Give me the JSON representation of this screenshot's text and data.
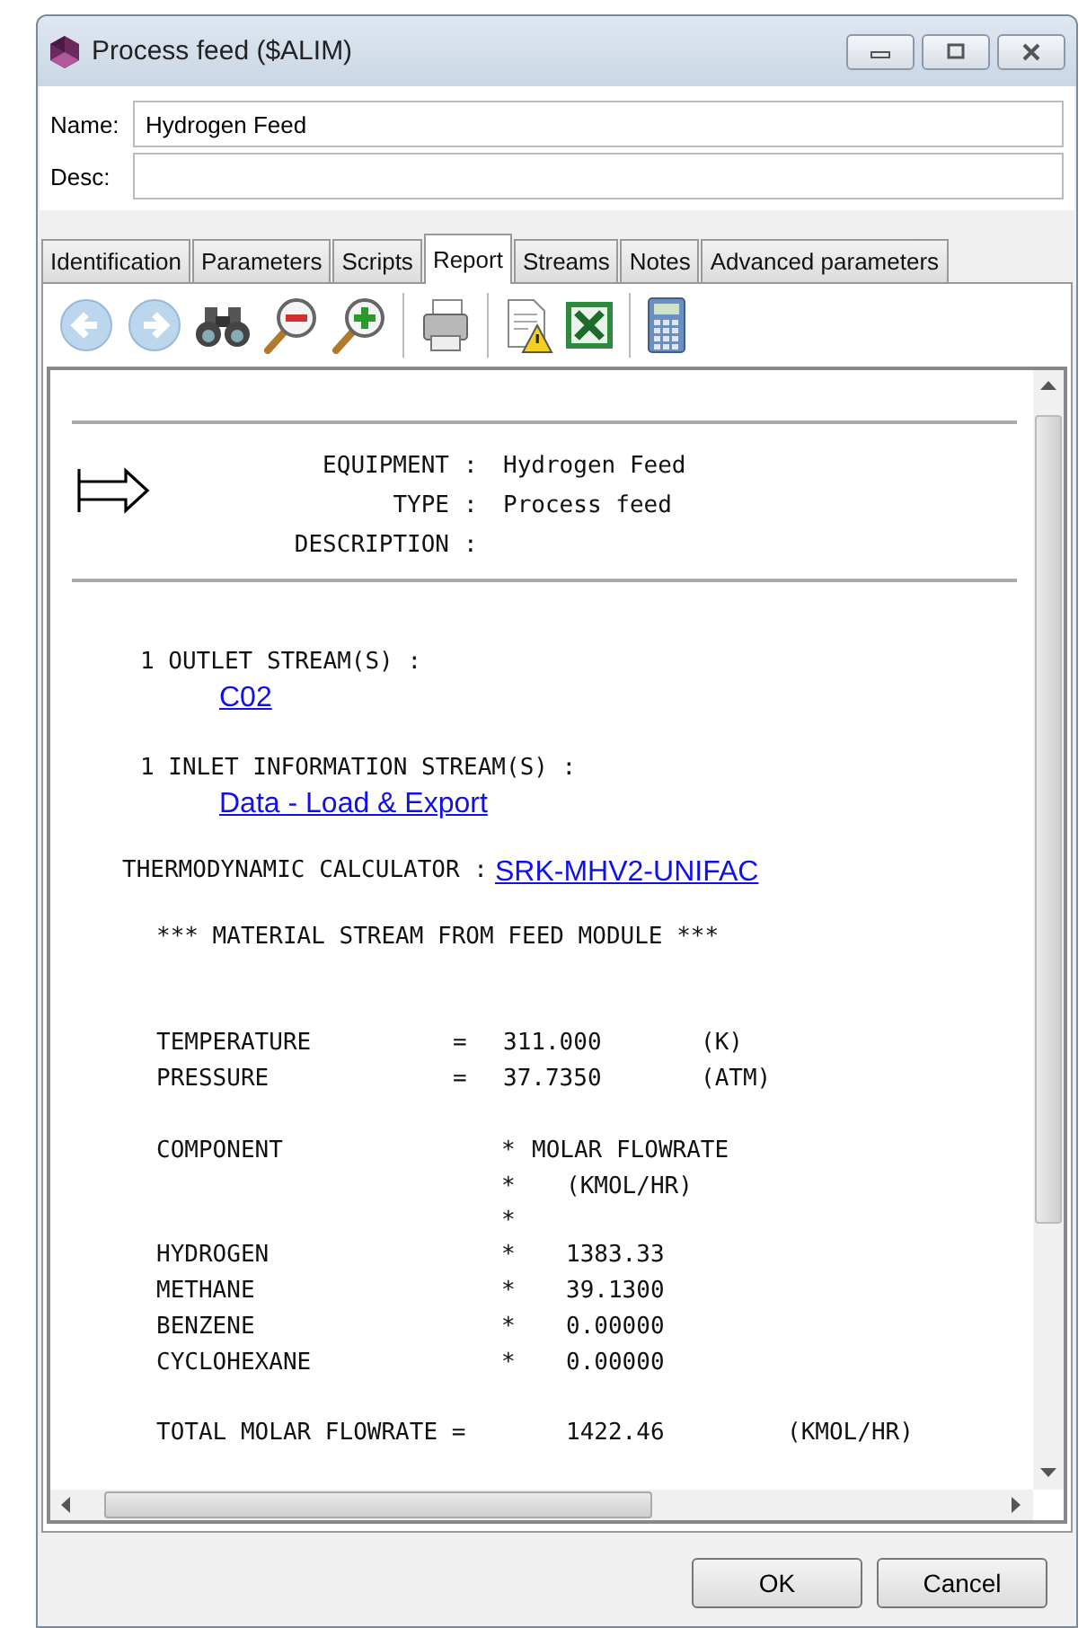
{
  "window": {
    "title": "Process feed ($ALIM)"
  },
  "fields": [
    {
      "label": "Name:",
      "value": "Hydrogen Feed"
    },
    {
      "label": "Desc:"
    }
  ],
  "tabs": [
    {
      "label": "Identification",
      "selected": false
    },
    {
      "label": "Parameters",
      "selected": false
    },
    {
      "label": "Scripts",
      "selected": false
    },
    {
      "label": "Report",
      "selected": true
    },
    {
      "label": "Streams",
      "selected": false
    },
    {
      "label": "Notes",
      "selected": false
    },
    {
      "label": "Advanced parameters",
      "selected": false
    }
  ],
  "toolbar": [
    {
      "kind": "back"
    },
    {
      "kind": "forward"
    },
    {
      "kind": "find"
    },
    {
      "kind": "zoom-out"
    },
    {
      "kind": "zoom-in"
    },
    {
      "kind": "separator"
    },
    {
      "kind": "print"
    },
    {
      "kind": "separator"
    },
    {
      "kind": "warning-doc"
    },
    {
      "kind": "excel"
    },
    {
      "kind": "separator"
    },
    {
      "kind": "calculator"
    }
  ],
  "report": {
    "header": [
      {
        "label": "EQUIPMENT",
        "separator": ":",
        "value": "Hydrogen Feed"
      },
      {
        "label": "TYPE",
        "separator": ":",
        "value": "Process feed"
      },
      {
        "label": "DESCRIPTION",
        "separator": ":"
      }
    ],
    "outlet": {
      "label": "1 OUTLET STREAM(S) :",
      "link": "C02"
    },
    "inlet": {
      "label": "1 INLET INFORMATION STREAM(S) :",
      "link": "Data - Load & Export"
    },
    "thermo": {
      "label": "THERMODYNAMIC CALCULATOR :",
      "link": "SRK-MHV2-UNIFAC"
    },
    "stream_title": "*** MATERIAL STREAM FROM FEED MODULE ***",
    "conditions": [
      {
        "name": "TEMPERATURE",
        "equals": "=",
        "value": "311.000",
        "unit": "(K)"
      },
      {
        "name": "PRESSURE",
        "equals": "=",
        "value": "37.7350",
        "unit": "(ATM)"
      }
    ],
    "components": [
      {
        "kind": "heading",
        "name": "COMPONENT",
        "star": "*",
        "value": "MOLAR FLOWRATE"
      },
      {
        "kind": "unit",
        "star": "*",
        "value": "(KMOL/HR)"
      },
      {
        "kind": "spacer",
        "star": "*"
      },
      {
        "kind": "value",
        "name": "HYDROGEN",
        "star": "*",
        "value": "1383.33"
      },
      {
        "kind": "value",
        "name": "METHANE",
        "star": "*",
        "value": "39.1300"
      },
      {
        "kind": "value",
        "name": "BENZENE",
        "star": "*",
        "value": "0.00000"
      },
      {
        "kind": "value",
        "name": "CYCLOHEXANE",
        "star": "*",
        "value": "0.00000"
      }
    ],
    "total": {
      "name": "TOTAL MOLAR FLOWRATE =",
      "value": "1422.46",
      "unit": "(KMOL/HR)"
    }
  },
  "buttons": [
    "OK",
    "Cancel"
  ]
}
